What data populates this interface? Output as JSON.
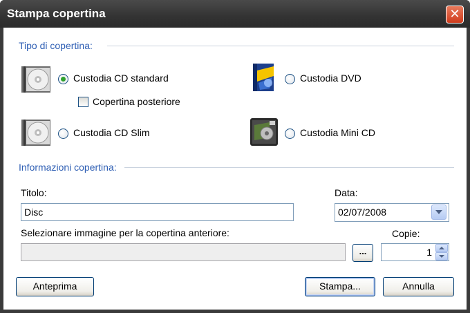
{
  "window": {
    "title": "Stampa copertina",
    "close_label": "✕"
  },
  "cover_type": {
    "group_label": "Tipo di copertina:",
    "options": {
      "cd_standard": {
        "label": "Custodia CD standard",
        "checked": true,
        "icon": "cd-case-icon"
      },
      "dvd": {
        "label": "Custodia DVD",
        "checked": false,
        "icon": "dvd-case-icon"
      },
      "cd_slim": {
        "label": "Custodia CD Slim",
        "checked": false,
        "icon": "cd-case-icon"
      },
      "mini_cd": {
        "label": "Custodia Mini CD",
        "checked": false,
        "icon": "mini-cd-case-icon"
      }
    },
    "back_cover": {
      "label": "Copertina posteriore",
      "checked": false
    }
  },
  "cover_info": {
    "group_label": "Informazioni copertina:",
    "title_label": "Titolo:",
    "title_value": "Disc",
    "date_label": "Data:",
    "date_value": "02/07/2008",
    "image_label": "Selezionare immagine per la copertina anteriore:",
    "image_value": "",
    "browse_label": "...",
    "copies_label": "Copie:",
    "copies_value": "1"
  },
  "buttons": {
    "preview": "Anteprima",
    "print": "Stampa...",
    "cancel": "Annulla"
  },
  "colors": {
    "group_label": "#2f5fb4",
    "radio_dot": "#2ea12e",
    "close": "#cf3b1c"
  }
}
